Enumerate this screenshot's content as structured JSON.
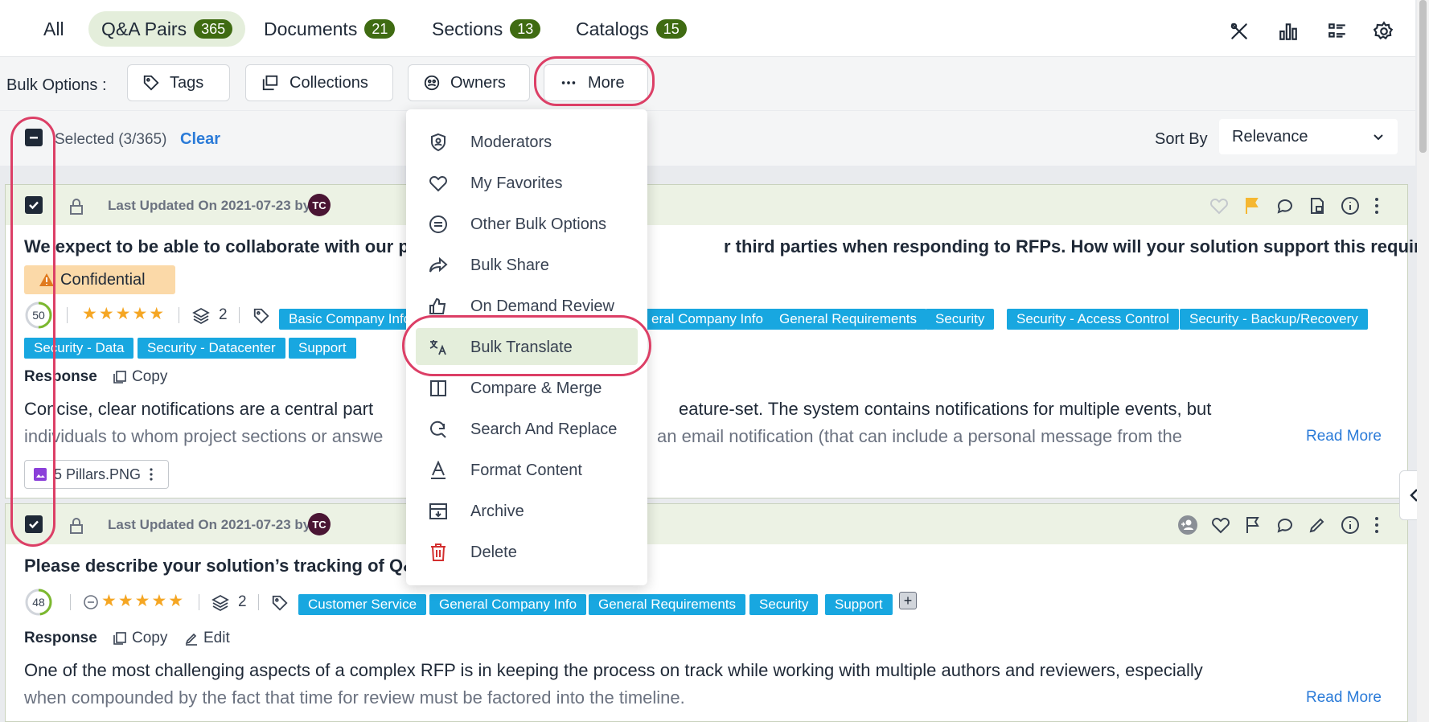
{
  "tabs": [
    {
      "label": "All",
      "count": ""
    },
    {
      "label": "Q&A Pairs",
      "count": "365"
    },
    {
      "label": "Documents",
      "count": "21"
    },
    {
      "label": "Sections",
      "count": "13"
    },
    {
      "label": "Catalogs",
      "count": "15"
    }
  ],
  "bulk": {
    "label": "Bulk Options :",
    "tags": "Tags",
    "collections": "Collections",
    "owners": "Owners",
    "more": "More"
  },
  "selection": {
    "text": "Selected (3/365)",
    "clear": "Clear",
    "sort_label": "Sort By",
    "sort_value": "Relevance"
  },
  "menu": {
    "items": [
      {
        "label": "Moderators",
        "icon": "moderator-shield-icon"
      },
      {
        "label": "My Favorites",
        "icon": "heart-icon"
      },
      {
        "label": "Other Bulk Options",
        "icon": "circle-lines-icon"
      },
      {
        "label": "Bulk Share",
        "icon": "share-arrow-icon"
      },
      {
        "label": "On Demand Review",
        "icon": "thumbs-up-icon"
      },
      {
        "label": "Bulk Translate",
        "icon": "translate-icon"
      },
      {
        "label": "Compare & Merge",
        "icon": "compare-columns-icon"
      },
      {
        "label": "Search And Replace",
        "icon": "search-refresh-icon"
      },
      {
        "label": "Format Content",
        "icon": "format-text-icon"
      },
      {
        "label": "Archive",
        "icon": "archive-box-icon"
      },
      {
        "label": "Delete",
        "icon": "trash-icon"
      }
    ],
    "highlighted": "Bulk Translate"
  },
  "cards": [
    {
      "updated": "Last Updated On 2021-07-23 by",
      "avatar": "TC",
      "question_left": "We expect to be able to collaborate with our pa",
      "question_right": "r third parties when responding to RFPs. How will your solution support this requirement?",
      "label": "Confidential",
      "score": "50",
      "score_fraction": 0.5,
      "rating": 5,
      "versions": "2",
      "tags": [
        "Basic Company Info",
        "eral Company Info",
        "General Requirements",
        "Security",
        "Security - Access Control",
        "Security - Backup/Recovery",
        "Security - Data",
        "Security - Datacenter",
        "Support"
      ],
      "response_label": "Response",
      "copy_label": "Copy",
      "body_line1_left": "Concise, clear notifications are a central part",
      "body_line1_right": "eature-set. The system contains notifications for multiple events, but",
      "body_line2_left": "individuals to whom project sections or answe",
      "body_line2_right": "an email notification (that can include a personal message from the",
      "read_more": "Read More",
      "file": "5 Pillars.PNG"
    },
    {
      "updated": "Last Updated On 2021-07-23 by",
      "avatar": "TC",
      "question_left": "Please describe your solution’s tracking of Q&A",
      "score": "48",
      "score_fraction": 0.48,
      "rating": 5,
      "versions": "2",
      "tags": [
        "Customer Service",
        "General Company Info",
        "General Requirements",
        "Security",
        "Support"
      ],
      "response_label": "Response",
      "copy_label": "Copy",
      "edit_label": "Edit",
      "body_line1": "One of the most challenging aspects of a complex RFP is in keeping the process on track while working with multiple authors and reviewers, especially",
      "body_line2": "when compounded by the fact that time for review must be factored into the timeline.",
      "read_more": "Read More"
    }
  ],
  "colors": {
    "accent_green": "#3f6b12",
    "tag_blue": "#18a7e0",
    "link_blue": "#2b7bd8",
    "highlight_ring": "#dc3f66",
    "confidential_bg": "#fbd9a8"
  }
}
